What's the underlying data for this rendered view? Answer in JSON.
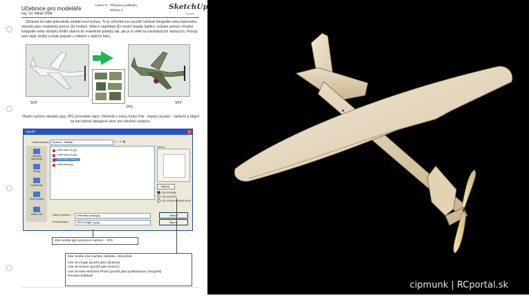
{
  "page": {
    "title": "Učebnice pro modeláře",
    "author": "Ing. Ivo Mikali 2008",
    "lesson_line1": "Lekce 5 - Příprava podkladu",
    "lesson_line2": "Strana 2",
    "logo": "SketchUp",
    "logo_sub": "Google",
    "paragraph_1": "Obrázek lze také jednoduše zařadit mezi textury. To je výhodné pro použití načtené fotografie nebo barevného obrázku jako realistický povrch 3D modelu. Máte-li například 3D model letadla Spitfire, můžete pomocí vhodné fotografie nebo obrázku křídlo obarvit do realistické podoby tak, jak je to vidět na následujících obrázcích. Postup není nijak složitý a bude popsán v některé z dalších lekcí.",
    "captions": {
      "left": "SKP",
      "middle": "JPG",
      "right": "SKP"
    },
    "paragraph_2": "Vlastní načtení obrázku typu JPG provedete takto: Otevřete v menu funkci File - Import (soubor - načtení) a objeví se toto běžné dialogové okno pro otevření souboru:",
    "callout_1": "Zde zvolíte typ souboru k načtení - JPG",
    "callout_2": {
      "line1": "Zde zvolíte účel načtení obrázku. Slovníček:",
      "line2": "Use as image (použít jako obrázek)",
      "line3": "Use as texture (použít jako texturu)",
      "line4": "Use as New Matched Photo (použít jako podkladovou fotografii)",
      "line5": "Preview (náhled)"
    }
  },
  "dialog": {
    "title": "Otevřít",
    "close": "×",
    "look_in_label": "Oblast hledání:",
    "look_in_value": "Textures - tiktaktik",
    "tools": "⇦ ⌂ ✦ ▦",
    "places": [
      "Poslední dokumenty",
      "Plocha",
      "Dokumenty",
      "Tento počítač",
      "Místa v síti"
    ],
    "files": [
      "Letterraba 01.jpg",
      "Letterraba 02.jpg",
      "Letterraba mass.jpg",
      "Letterraba.jpg"
    ],
    "selected_file_index": 2,
    "preview_label": "Náhled",
    "options_button": "Options...",
    "radios": [
      "Use as image",
      "Use as texture",
      "Use as New Matched Photo"
    ],
    "selected_radio_index": 0,
    "filename_label": "Název souboru:",
    "filename_value": "Letterraba mass.jpg",
    "filetype_label": "Soubory typu:",
    "filetype_value": "JPEG Image (*.jpg)",
    "open_button": "Otevřít",
    "cancel_button": "Storno"
  },
  "viewport": {
    "watermark": "cipmunk | RCportal.sk"
  },
  "colors": {
    "arrow": "#1db84f",
    "titlebar": "#2553c9",
    "viewport_bg": "#000000",
    "wood": "#e9dcc6"
  }
}
